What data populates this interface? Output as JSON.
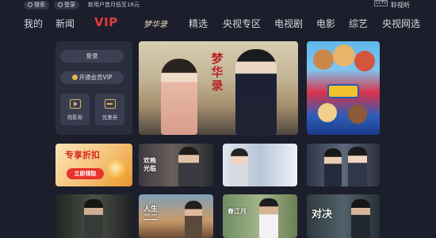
{
  "topbar": {
    "search_label": "搜索",
    "login_label": "登录",
    "promo_text": "新用户首月低至16元",
    "cctv_label": "CCTV",
    "brand_label": "聆视听"
  },
  "nav": {
    "items": [
      "我的",
      "新闻",
      "VIP",
      "梦华录",
      "精选",
      "央视专区",
      "电视剧",
      "电影",
      "综艺",
      "央视网选"
    ]
  },
  "sidebar": {
    "login_button": "登录",
    "vip_button": "开通会员VIP",
    "tiles": [
      "观影券",
      "优惠券"
    ]
  },
  "hero": {
    "title": "梦华录"
  },
  "promo_card": {
    "headline": "专享折扣",
    "cta": "立即领取"
  },
  "thumbnails": {
    "row1_caption": "欢晚 光临",
    "row2_captions": [
      "",
      "人生 二二",
      "春江月",
      "对决"
    ]
  },
  "colors": {
    "background": "#1c1e2b",
    "accent_vip": "#e23b3b",
    "gold": "#e0b35a"
  }
}
